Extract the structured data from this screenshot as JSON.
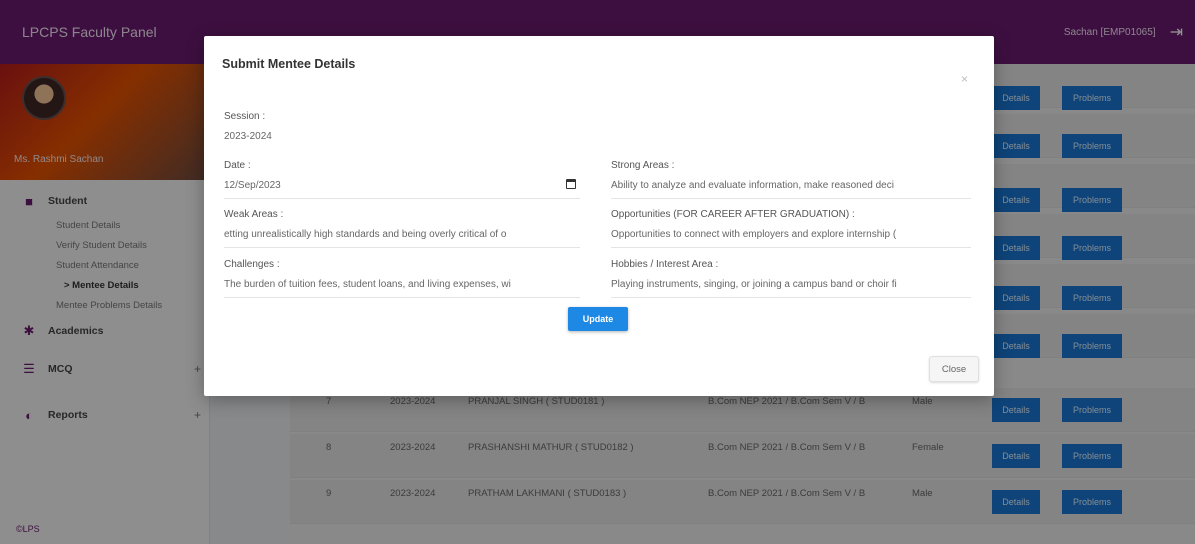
{
  "app": {
    "brand": "LPCPS Faculty Panel",
    "user_label": "Sachan [EMP01065]",
    "footer": "©LPS"
  },
  "sidebar": {
    "profile_name": "Ms. Rashmi Sachan",
    "sections": [
      {
        "label": "Student",
        "icon": "graduation-icon",
        "subitems": [
          {
            "label": "Student Details"
          },
          {
            "label": "Verify Student Details"
          },
          {
            "label": "Student Attendance"
          },
          {
            "label": "> Mentee Details",
            "active": true
          },
          {
            "label": "Mentee Problems Details"
          }
        ]
      },
      {
        "label": "Academics",
        "icon": "gear-icon"
      },
      {
        "label": "MCQ",
        "icon": "mcq-icon"
      },
      {
        "label": "Reports",
        "icon": "reports-icon"
      }
    ]
  },
  "table": {
    "details_label": "Details",
    "problems_label": "Problems",
    "rows": [
      {
        "no": "7",
        "session": "2023-2024",
        "name": "PRANJAL SINGH ( STUD0181 )",
        "course": "B.Com NEP 2021 / B.Com Sem V / B",
        "gender": "Male"
      },
      {
        "no": "8",
        "session": "2023-2024",
        "name": "PRASHANSHI MATHUR ( STUD0182 )",
        "course": "B.Com NEP 2021 / B.Com Sem V / B",
        "gender": "Female"
      },
      {
        "no": "9",
        "session": "2023-2024",
        "name": "PRATHAM LAKHMANI ( STUD0183 )",
        "course": "B.Com NEP 2021 / B.Com Sem V / B",
        "gender": "Male"
      }
    ]
  },
  "modal": {
    "title": "Submit Mentee Details",
    "close_x": "×",
    "session_label": "Session :",
    "session_value": "2023-2024",
    "date_label": "Date :",
    "date_value": "12/Sep/2023",
    "strong_label": "Strong Areas :",
    "strong_value": "Ability to analyze and evaluate information, make reasoned deci",
    "weak_label": "Weak Areas :",
    "weak_value": "etting unrealistically high standards and being overly critical of o",
    "opp_label": "Opportunities (FOR CAREER AFTER GRADUATION) :",
    "opp_value": "Opportunities to connect with employers and explore internship (",
    "chal_label": "Challenges :",
    "chal_value": "The burden of tuition fees, student loans, and living expenses, wi",
    "hobby_label": "Hobbies / Interest Area :",
    "hobby_value": "Playing instruments, singing, or joining a campus band or choir fi",
    "update_label": "Update",
    "close_label": "Close"
  }
}
